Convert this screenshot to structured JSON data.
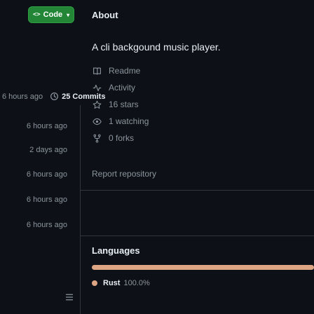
{
  "toolbar": {
    "code_label": "Code",
    "code_glyph": "<>",
    "caret": "▾"
  },
  "about": {
    "title": "About",
    "description": "A cli backgound music player.",
    "items": [
      {
        "icon": "book-icon",
        "label": "Readme"
      },
      {
        "icon": "pulse-icon",
        "label": "Activity"
      },
      {
        "icon": "star-icon",
        "label": "16 stars"
      },
      {
        "icon": "eye-icon",
        "label": "1 watching"
      },
      {
        "icon": "fork-icon",
        "label": "0 forks"
      }
    ],
    "report": "Report repository"
  },
  "commits": {
    "time": "6 hours ago",
    "count_label": "25 Commits"
  },
  "file_times": [
    "6 hours ago",
    "2 days ago",
    "6 hours ago",
    "6 hours ago",
    "6 hours ago"
  ],
  "languages": {
    "title": "Languages",
    "items": [
      {
        "name": "Rust",
        "percent": "100.0%",
        "color": "#dea584"
      }
    ]
  },
  "colors": {
    "accent": "#238636",
    "bg": "#0d1117",
    "muted": "#8b949e",
    "rust": "#dea584"
  }
}
